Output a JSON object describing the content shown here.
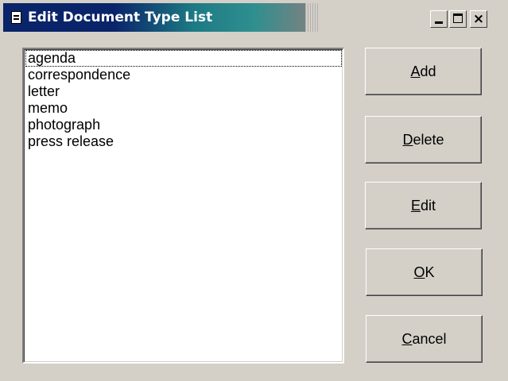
{
  "window": {
    "title": "Edit Document Type List",
    "controls": {
      "minimize": "minimize-icon",
      "maximize": "maximize-icon",
      "close": "×"
    }
  },
  "list": {
    "items": [
      "agenda",
      "correspondence",
      "letter",
      "memo",
      "photograph",
      "press release"
    ],
    "focused_index": 0
  },
  "buttons": {
    "add": {
      "mnemonic": "A",
      "rest": "dd"
    },
    "delete": {
      "mnemonic": "D",
      "rest": "elete"
    },
    "edit": {
      "mnemonic": "E",
      "rest": "dit"
    },
    "ok": {
      "mnemonic": "O",
      "rest": "K"
    },
    "cancel": {
      "mnemonic": "C",
      "rest": "ancel"
    }
  },
  "colors": {
    "title_active": "#0a246a",
    "title_gradient_mid": "#2f8f8f",
    "face": "#d4d0c8",
    "list_background": "#ffffff"
  }
}
